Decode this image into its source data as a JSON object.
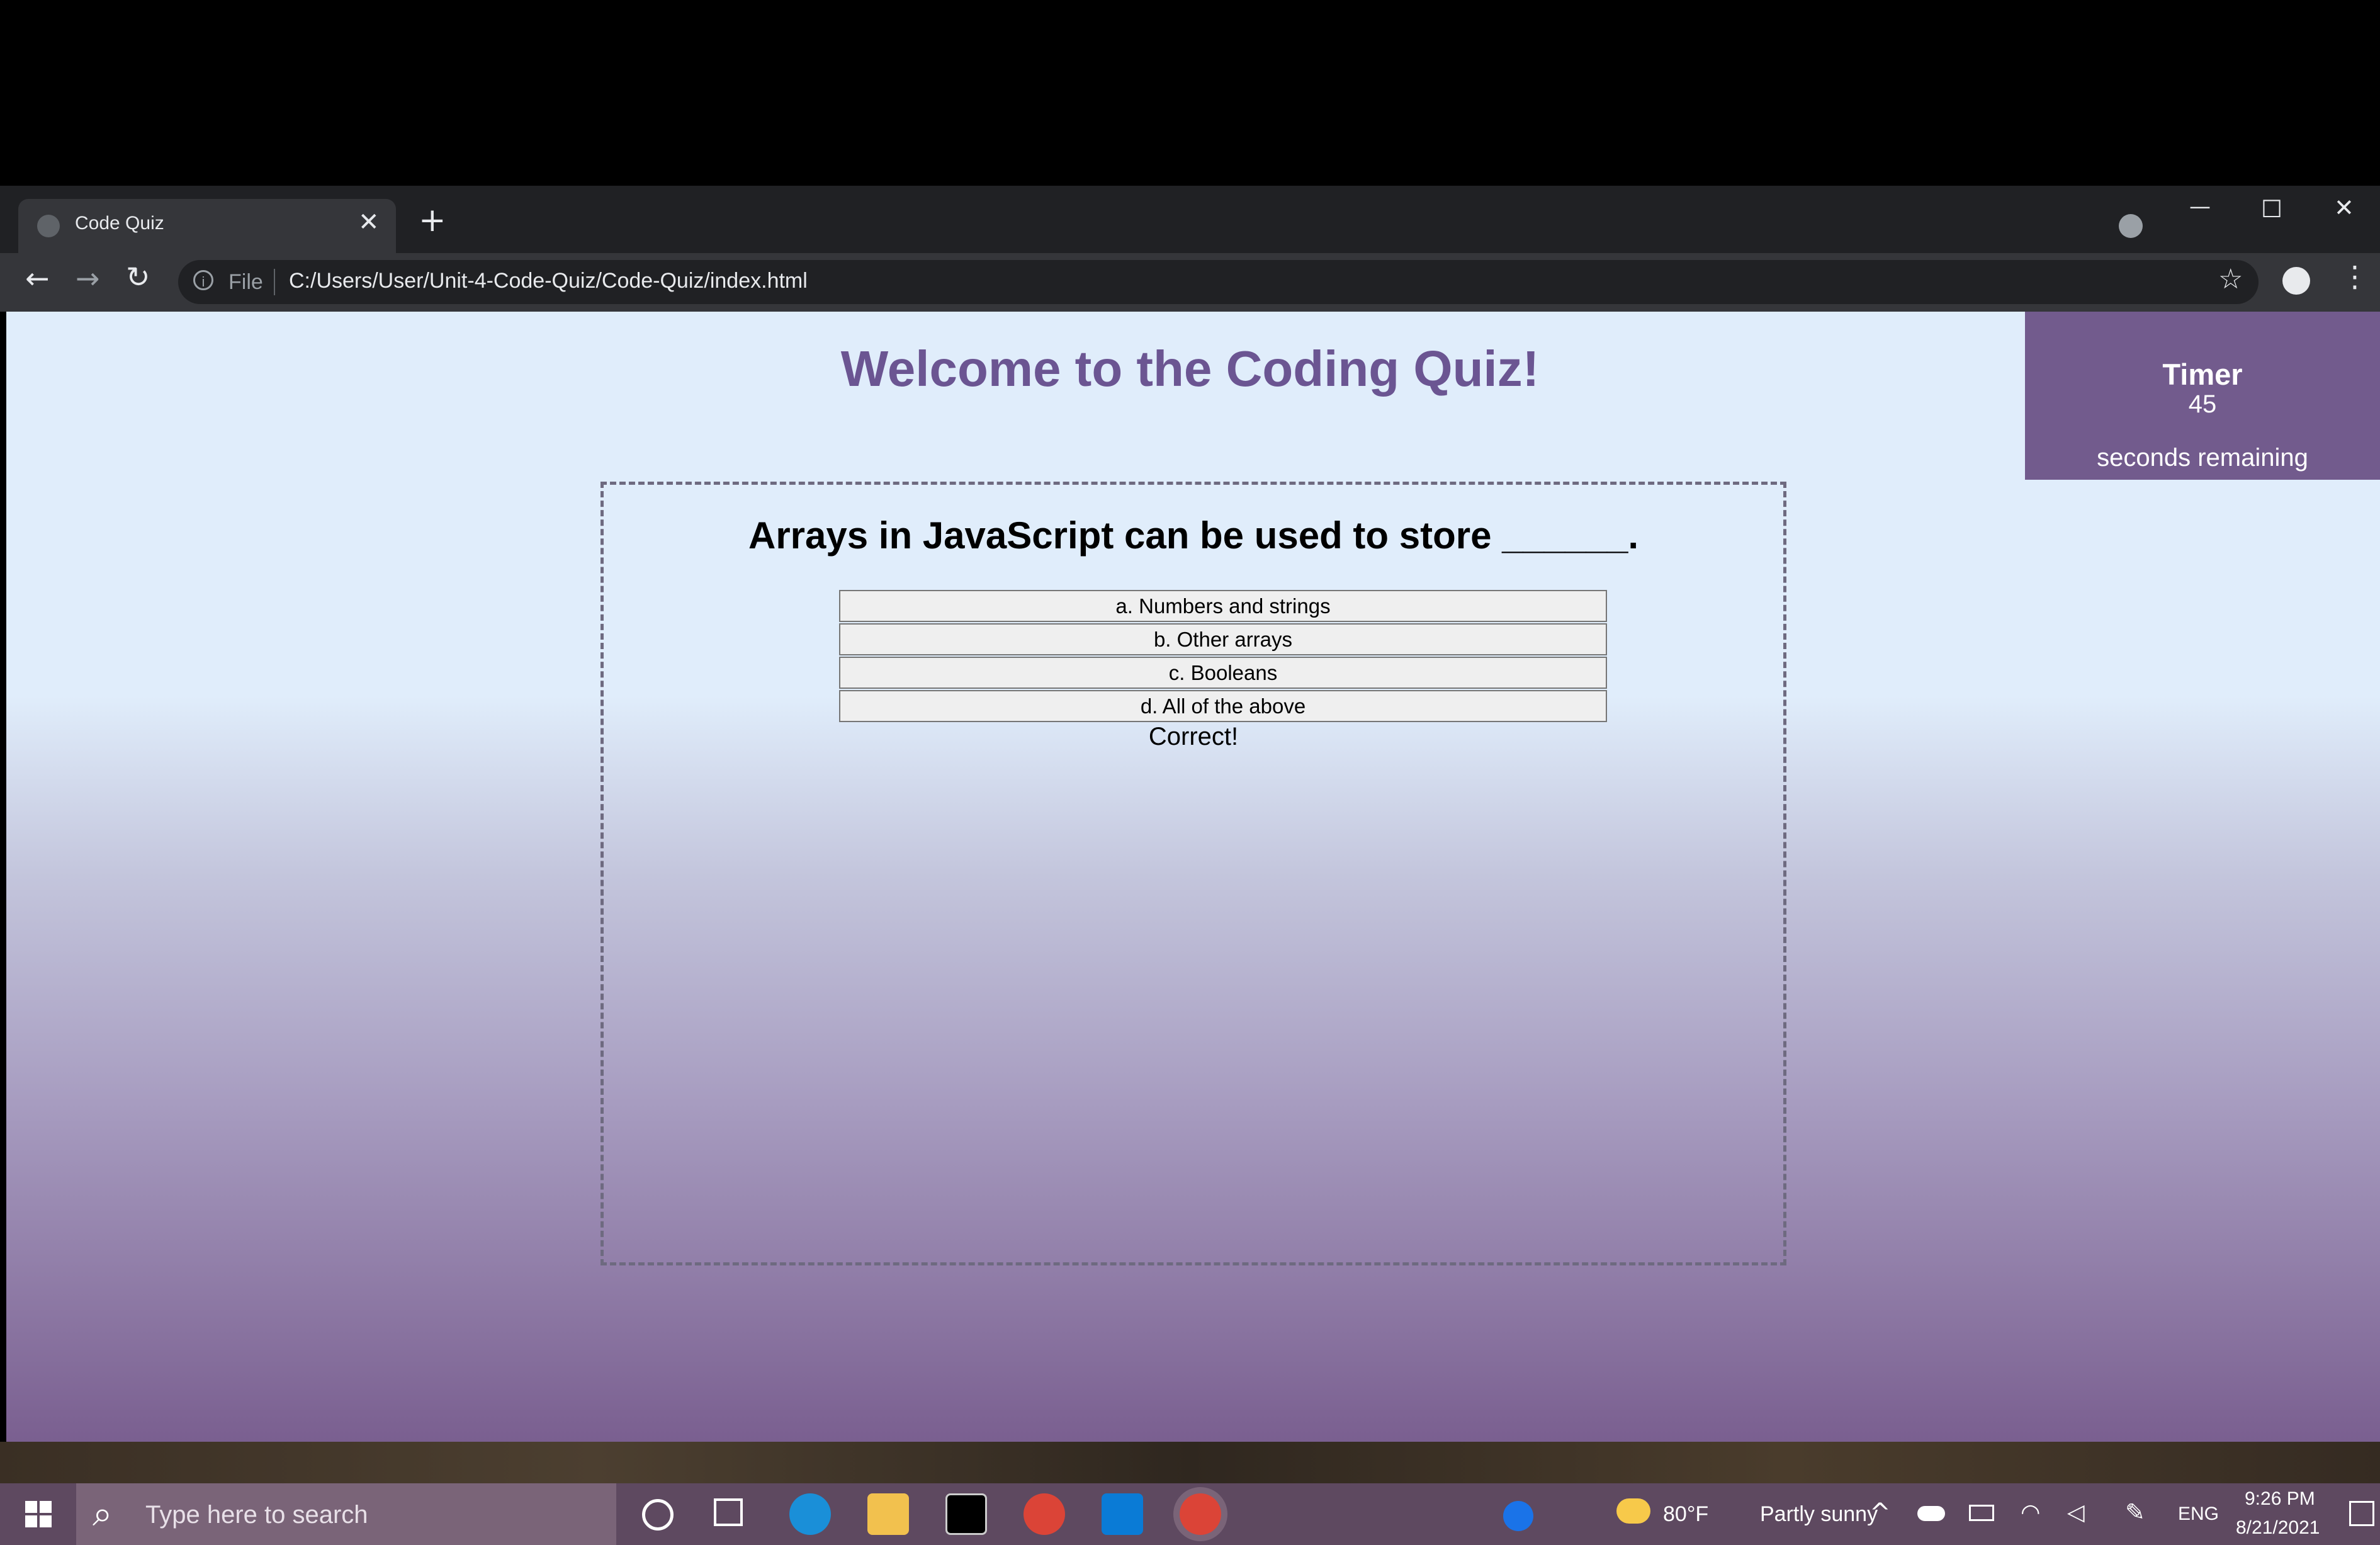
{
  "browser": {
    "tab_title": "Code Quiz",
    "tab_close": "✕",
    "new_tab": "+",
    "omnibox_label": "File",
    "url": "C:/Users/User/Unit-4-Code-Quiz/Code-Quiz/index.html",
    "window_controls": [
      "—",
      "☐",
      "✕"
    ]
  },
  "page": {
    "heading": "Welcome to the Coding Quiz!",
    "timer": {
      "label": "Timer",
      "value": "45",
      "suffix": "seconds remaining"
    },
    "question": "Arrays in JavaScript can be used to store ______.",
    "answers": [
      "a. Numbers and strings",
      "b. Other arrays",
      "c. Booleans",
      "d. All of the above"
    ],
    "feedback": "Correct!"
  },
  "taskbar": {
    "search_placeholder": "Type here to search",
    "weather_temp": "80°F",
    "weather_desc": "Partly sunny",
    "language": "ENG",
    "time": "9:26 PM",
    "date": "8/21/2021"
  },
  "colors": {
    "heading": "#6b5592",
    "timer_bg": "#725b8d",
    "chrome_bg": "#202124",
    "taskbar_bg": "#5e4960"
  }
}
